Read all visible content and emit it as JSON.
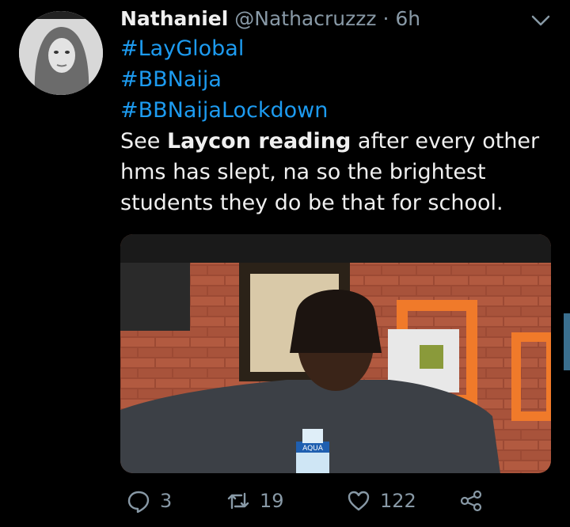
{
  "tweet": {
    "author_name": "Nathaniel",
    "handle": "@Nathacruzzz",
    "separator": "·",
    "time": "6h",
    "hashtags": [
      "#LayGlobal",
      "#BBNaija",
      "#BBNaijaLockdown"
    ],
    "text_prefix": "See ",
    "text_bold": "Laycon reading",
    "text_suffix": " after every other hms has slept, na so the brightest students they do be that for school.",
    "media_bottle_label": "AQUA"
  },
  "actions": {
    "reply_count": "3",
    "retweet_count": "19",
    "like_count": "122"
  },
  "icons": {
    "avatar": "profile-photo",
    "menu": "chevron-down-icon",
    "reply": "comment-icon",
    "retweet": "retweet-icon",
    "like": "heart-icon",
    "share": "share-icon"
  },
  "colors": {
    "background": "#000000",
    "link": "#1d9bf0",
    "muted": "#8899a6",
    "text": "#f0f0f0"
  }
}
